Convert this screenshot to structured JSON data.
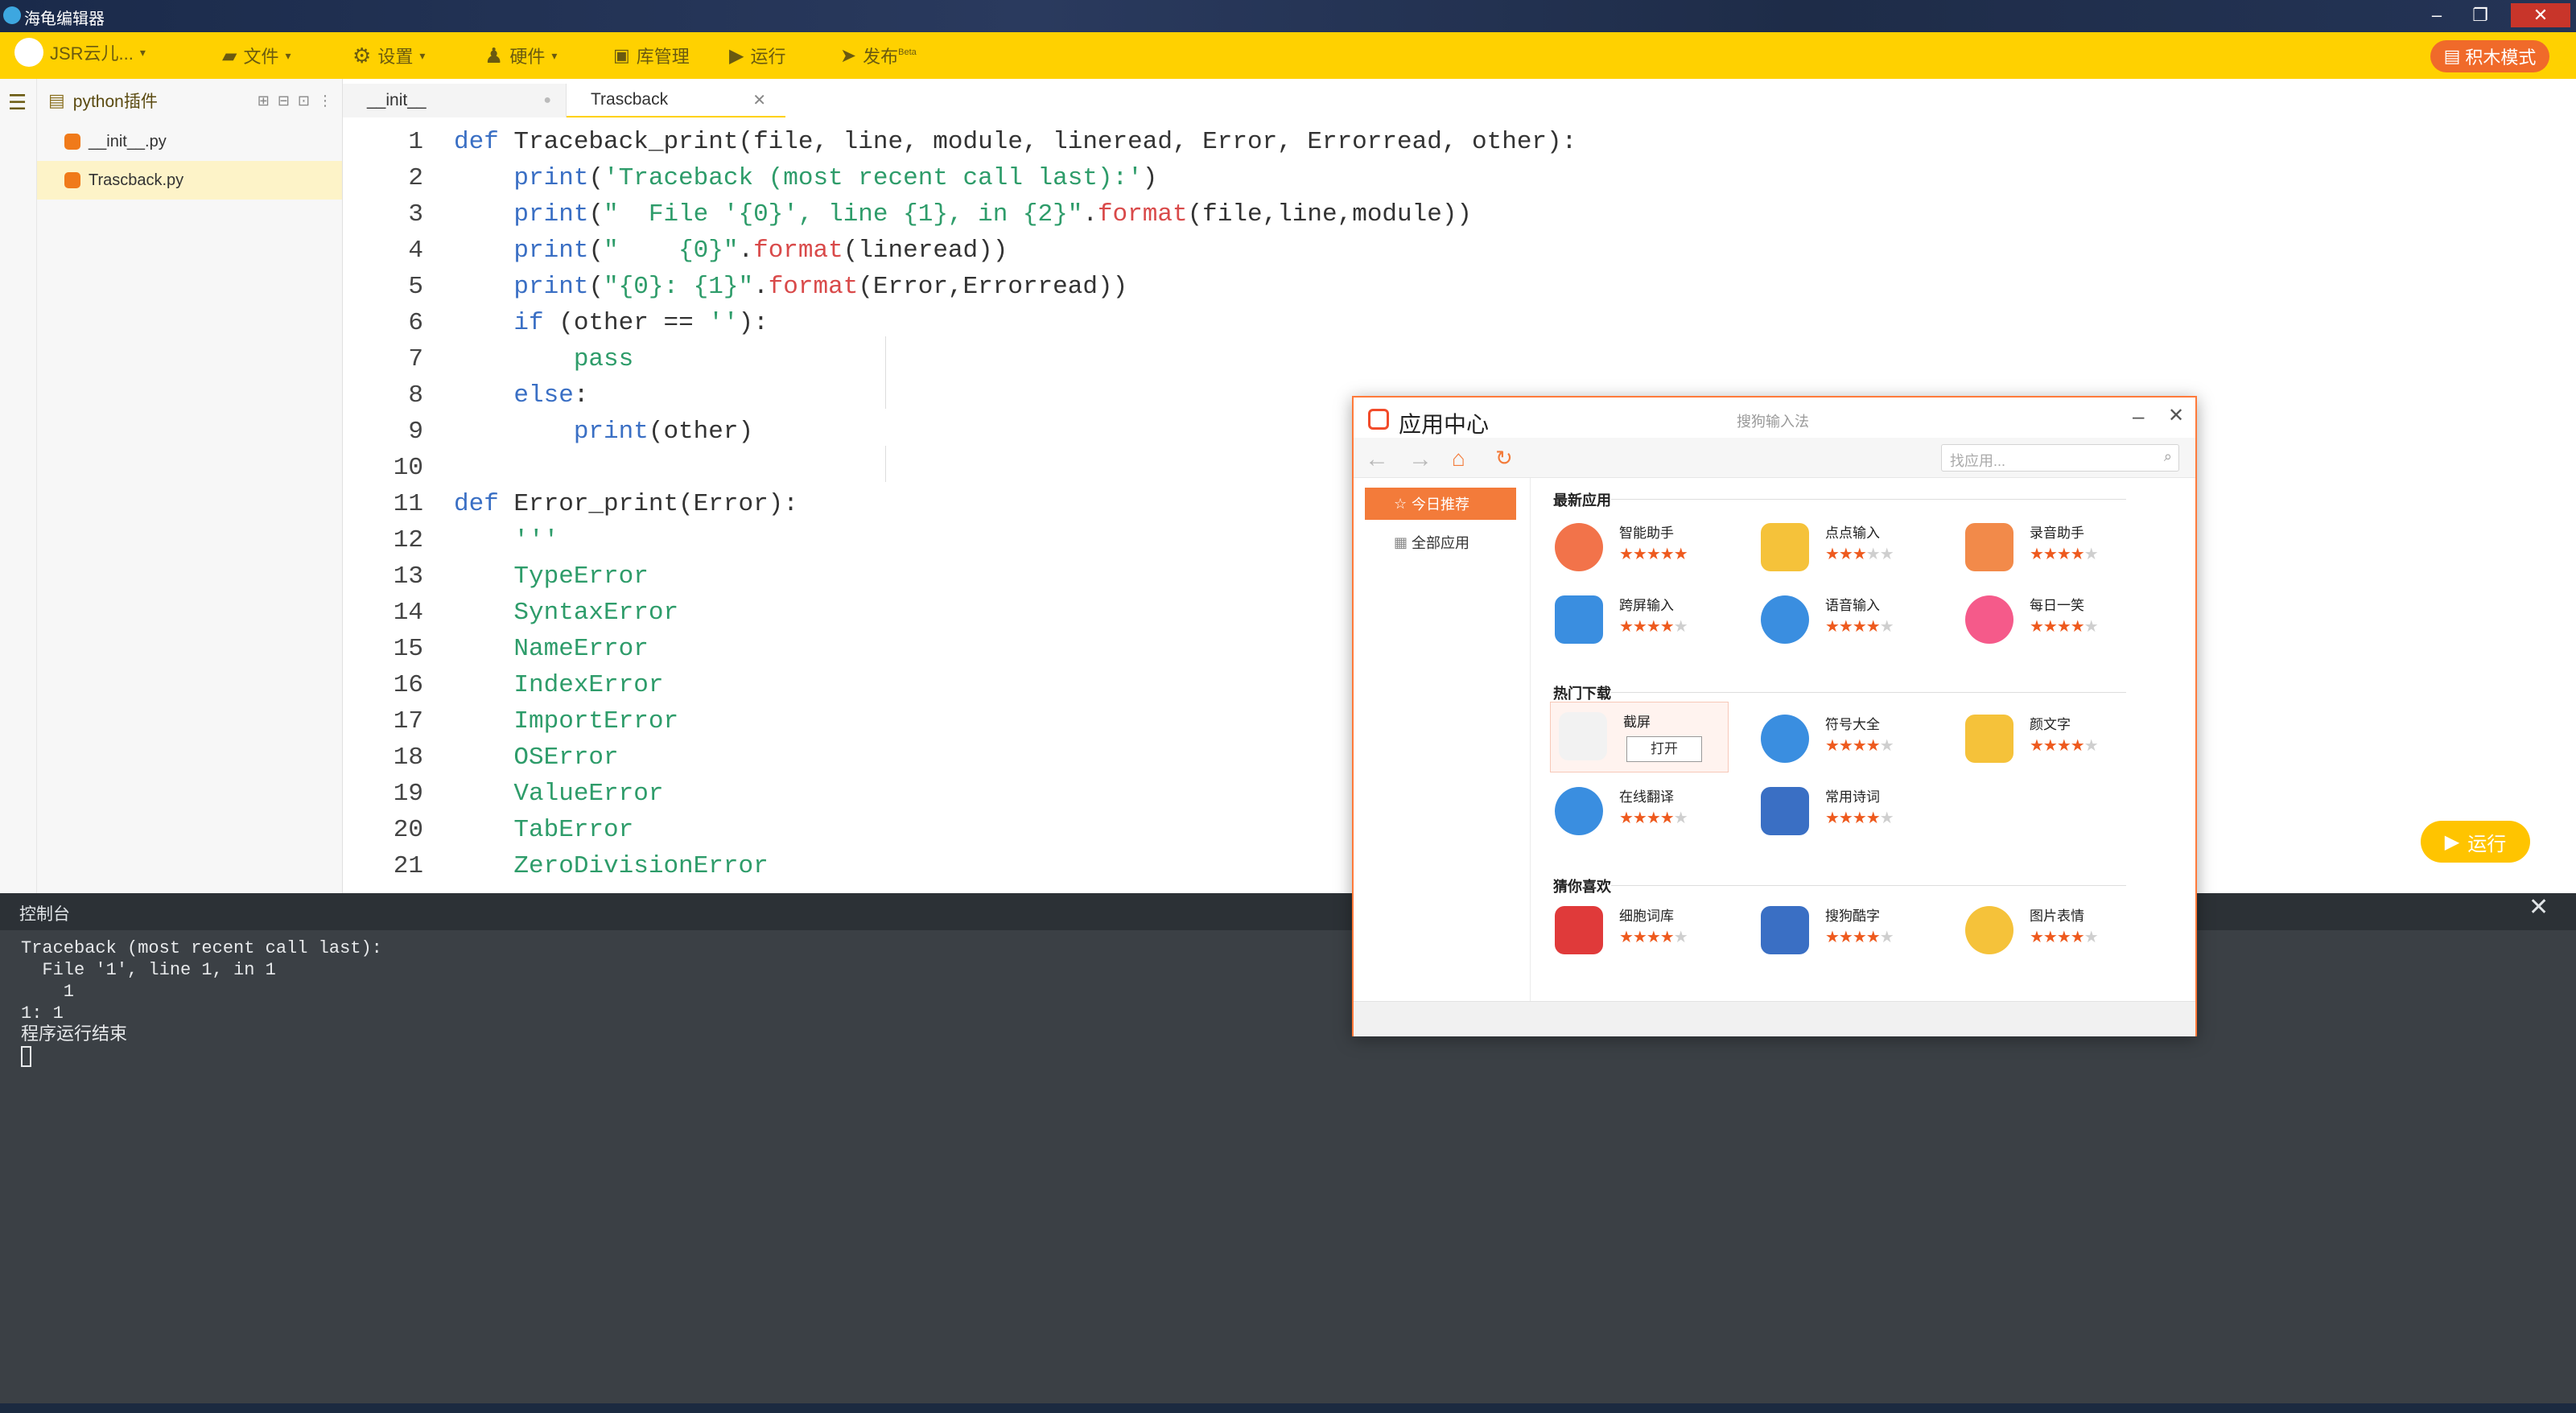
{
  "window": {
    "title": "海龟编辑器"
  },
  "toolbar": {
    "account": "JSR云儿...",
    "file": "文件",
    "settings": "设置",
    "hardware": "硬件",
    "library": "库管理",
    "run": "运行",
    "publish": "发布",
    "publish_badge": "Beta",
    "blocks_mode": "积木模式"
  },
  "sidebar": {
    "project": "python插件",
    "files": [
      "__init__.py",
      "Trascback.py"
    ]
  },
  "tabs": [
    "__init__",
    "Trascback"
  ],
  "editor": {
    "line_numbers": [
      "1",
      "2",
      "3",
      "4",
      "5",
      "6",
      "7",
      "8",
      "9",
      "10",
      "11",
      "12",
      "13",
      "14",
      "15",
      "16",
      "17",
      "18",
      "19",
      "20",
      "21"
    ]
  },
  "run_button": "运行",
  "console": {
    "title": "控制台",
    "lines": [
      "Traceback (most recent call last):",
      "  File '1', line 1, in 1",
      "    1",
      "1: 1",
      "程序运行结束"
    ]
  },
  "app_center": {
    "title": "应用中心",
    "subtitle": "搜狗输入法",
    "search_placeholder": "找应用...",
    "nav": {
      "today": "今日推荐",
      "all": "全部应用"
    },
    "sections": {
      "latest": "最新应用",
      "hot": "热门下载",
      "guess": "猜你喜欢"
    },
    "apps_latest": [
      {
        "name": "智能助手",
        "rating": 5
      },
      {
        "name": "点点输入",
        "rating": 3
      },
      {
        "name": "录音助手",
        "rating": 3.5
      },
      {
        "name": "跨屏输入",
        "rating": 4
      },
      {
        "name": "语音输入",
        "rating": 4
      },
      {
        "name": "每日一笑",
        "rating": 4
      }
    ],
    "apps_hot": [
      {
        "name": "截屏",
        "rating": 0
      },
      {
        "name": "符号大全",
        "rating": 4
      },
      {
        "name": "颜文字",
        "rating": 4
      },
      {
        "name": "在线翻译",
        "rating": 4
      },
      {
        "name": "常用诗词",
        "rating": 4
      }
    ],
    "open_label": "打开",
    "apps_guess": [
      {
        "name": "细胞词库",
        "rating": 3.5
      },
      {
        "name": "搜狗酷字",
        "rating": 4
      },
      {
        "name": "图片表情",
        "rating": 4
      }
    ],
    "colors": {
      "accent": "#f37b3a"
    }
  },
  "colors": {
    "toolbar": "#ffd100",
    "run": "#ffc400",
    "console_bg": "#3b4045"
  }
}
